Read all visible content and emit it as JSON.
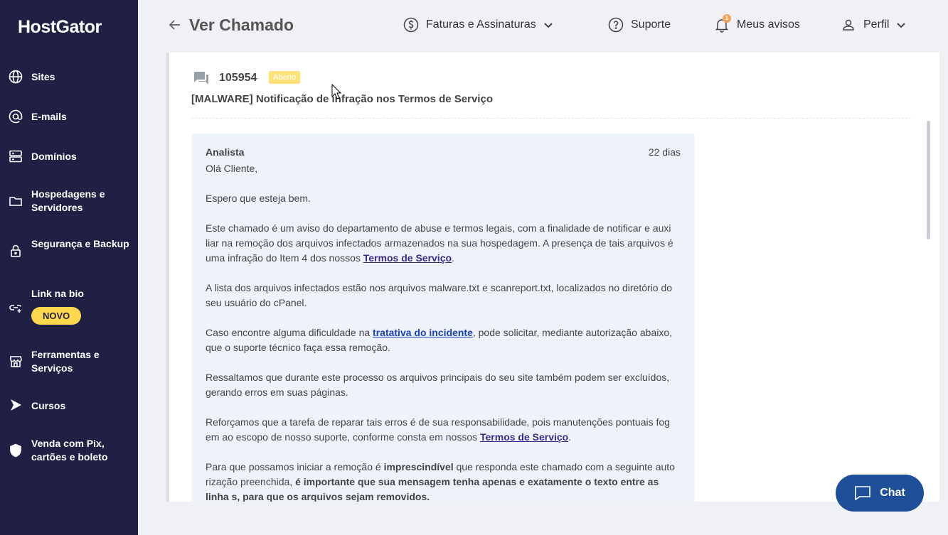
{
  "brand": {
    "logo_text": "HostGator"
  },
  "sidebar": {
    "items": [
      {
        "label": "Sites",
        "icon": "globe-icon"
      },
      {
        "label": "E-mails",
        "icon": "at-icon"
      },
      {
        "label": "Domínios",
        "icon": "server-icon"
      },
      {
        "label": "Hospedagens e Servidores",
        "icon": "folder-icon"
      },
      {
        "label": "Segurança e Backup",
        "icon": "lock-icon"
      },
      {
        "label": "Link na bio",
        "icon": "link-icon",
        "badge": "NOVO"
      },
      {
        "label": "Ferramentas e Serviços",
        "icon": "store-icon"
      },
      {
        "label": "Cursos",
        "icon": "play-icon"
      },
      {
        "label": "Venda com Pix, cartões e boleto",
        "icon": "shield-icon"
      }
    ]
  },
  "header": {
    "title": "Ver Chamado",
    "billing_label": "Faturas e Assinaturas",
    "support_label": "Suporte",
    "notices_label": "Meus avisos",
    "notices_count": "1",
    "profile_label": "Perfil"
  },
  "ticket": {
    "id": "105954",
    "status": "Aberto",
    "subject": "[MALWARE] Notificação de infração nos Termos de Serviço"
  },
  "message": {
    "author": "Analista",
    "time": "22 dias",
    "greeting": "Olá Cliente,",
    "p1": "Espero que esteja bem.",
    "p2_a": "Este chamado é um aviso do departamento de abuse e termos legais, com a finalidade de notificar e auxi liar na remoção dos arquivos infectados armazenados na sua hospedagem. A presença de tais arquivos é uma infração do Item 4 dos nossos ",
    "p2_link": "Termos de Serviço",
    "p2_b": ".",
    "p3": "A lista dos arquivos infectados estão nos arquivos malware.txt e scanreport.txt, localizados no diretório do seu usuário do cPanel.",
    "p4_a": "Caso encontre alguma dificuldade na ",
    "p4_link": "tratativa do incidente",
    "p4_b": ", pode solicitar, mediante autorização abaixo, que o suporte técnico faça essa remoção.",
    "p5": "Ressaltamos que durante este processo os arquivos principais do seu site também podem ser excluídos, gerando erros em suas páginas.",
    "p6_a": "Reforçamos que a tarefa de reparar tais erros é de sua responsabilidade, pois manutenções pontuais fog em ao escopo de nosso suporte, conforme consta em nossos ",
    "p6_link": "Termos de Serviço",
    "p6_b": ".",
    "p7_a": "Para que possamos iniciar a remoção é ",
    "p7_bold1": "imprescindível",
    "p7_b": " que responda este chamado com a seguinte auto rização preenchida, ",
    "p7_bold2": "é importante que sua mensagem tenha apenas e exatamente o texto entre as linha s, para que os arquivos sejam removidos."
  },
  "chat": {
    "label": "Chat"
  },
  "colors": {
    "sidebar_bg": "#1f2044",
    "badge_yellow": "#ffd84d",
    "chat_blue": "#1f4f99"
  }
}
